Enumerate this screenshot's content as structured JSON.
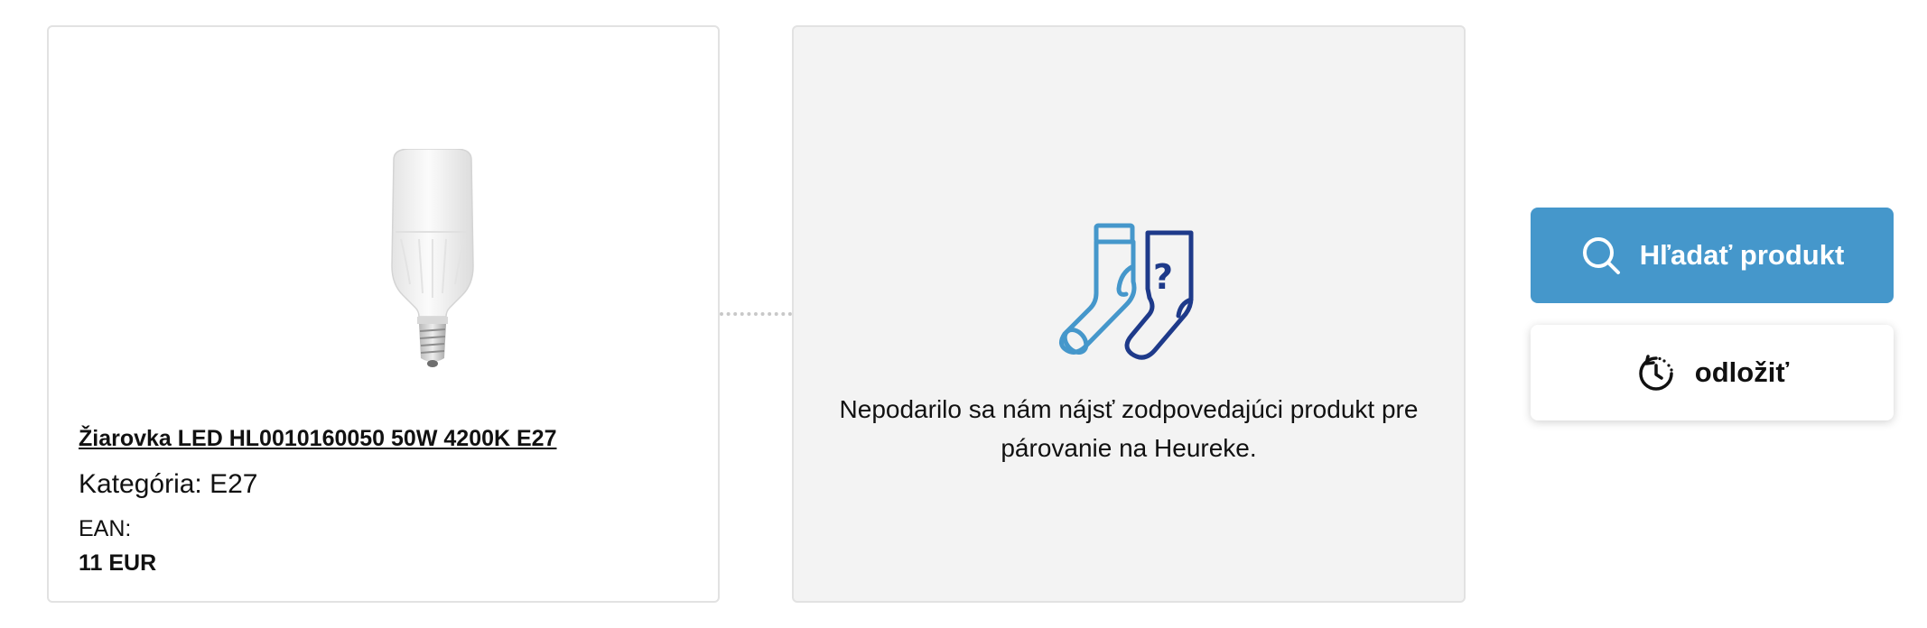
{
  "product": {
    "name": "Žiarovka LED HL0010160050 50W 4200K E27",
    "category_label": "Kategória:",
    "category_value": "E27",
    "ean_label": "EAN:",
    "price": "11 EUR"
  },
  "match": {
    "message": "Nepodarilo sa nám nájsť zodpovedajúci produkt pre párovanie na Heureke.",
    "icon": "socks-question-icon"
  },
  "actions": {
    "search_label": "Hľadať produkt",
    "postpone_label": "odložiť"
  },
  "colors": {
    "primary": "#4597cb",
    "sock_light": "#4597cb",
    "sock_dark": "#1e3a8a",
    "card_gray": "#f3f3f3"
  }
}
